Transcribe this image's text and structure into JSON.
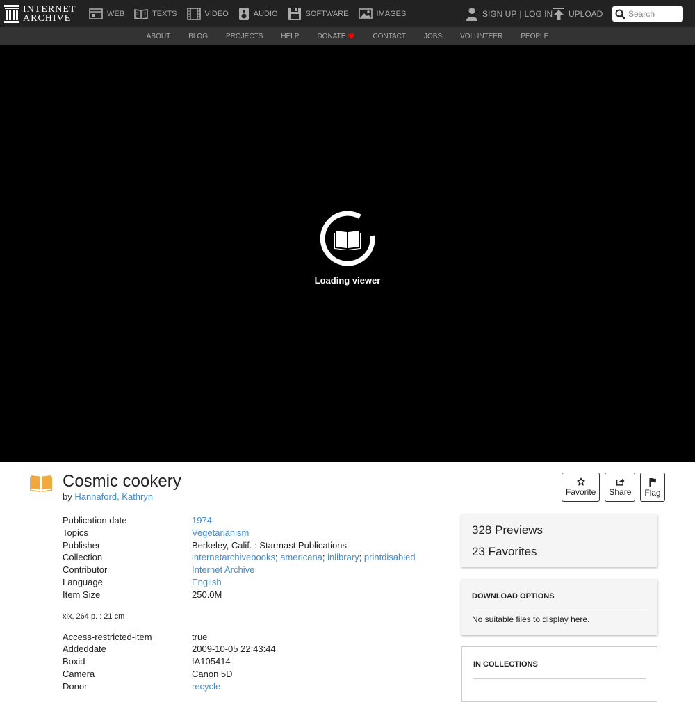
{
  "brand": {
    "line1": "INTERNET",
    "line2": "ARCHIVE"
  },
  "media_nav": [
    {
      "label": "WEB",
      "icon": "web-icon"
    },
    {
      "label": "TEXTS",
      "icon": "texts-icon"
    },
    {
      "label": "VIDEO",
      "icon": "video-icon"
    },
    {
      "label": "AUDIO",
      "icon": "audio-icon"
    },
    {
      "label": "SOFTWARE",
      "icon": "software-icon"
    },
    {
      "label": "IMAGES",
      "icon": "images-icon"
    }
  ],
  "user": {
    "signup": "SIGN UP",
    "separator": "|",
    "login": "LOG IN",
    "upload": "UPLOAD"
  },
  "search": {
    "placeholder": "Search"
  },
  "sub_nav": [
    "ABOUT",
    "BLOG",
    "PROJECTS",
    "HELP",
    "DONATE",
    "CONTACT",
    "JOBS",
    "VOLUNTEER",
    "PEOPLE"
  ],
  "viewer": {
    "loading_text": "Loading viewer"
  },
  "item": {
    "title": "Cosmic cookery",
    "by_label": "by",
    "author": "Hannaford, Kathryn"
  },
  "actions": {
    "favorite": "Favorite",
    "share": "Share",
    "flag": "Flag"
  },
  "metadata": {
    "publication_date": {
      "key": "Publication date",
      "value": "1974"
    },
    "topics": {
      "key": "Topics",
      "value": "Vegetarianism"
    },
    "publisher": {
      "key": "Publisher",
      "value": "Berkeley, Calif. : Starmast Publications"
    },
    "collection": {
      "key": "Collection",
      "values": [
        "internetarchivebooks",
        "americana",
        "inlibrary",
        "printdisabled"
      ]
    },
    "contributor": {
      "key": "Contributor",
      "value": "Internet Archive"
    },
    "language": {
      "key": "Language",
      "value": "English"
    },
    "item_size": {
      "key": "Item Size",
      "value": "250.0M"
    },
    "note": "xix, 264 p. : 21 cm",
    "access_restricted": {
      "key": "Access-restricted-item",
      "value": "true"
    },
    "addeddate": {
      "key": "Addeddate",
      "value": "2009-10-05 22:43:44"
    },
    "boxid": {
      "key": "Boxid",
      "value": "IA105414"
    },
    "camera": {
      "key": "Camera",
      "value": "Canon 5D"
    },
    "donor": {
      "key": "Donor",
      "value": "recycle"
    }
  },
  "stats": {
    "previews": "328 Previews",
    "favorites": "23 Favorites"
  },
  "download": {
    "heading": "DOWNLOAD OPTIONS",
    "note": "No suitable files to display here."
  },
  "collections": {
    "heading": "IN COLLECTIONS"
  },
  "colors": {
    "link": "#428bca",
    "nav_bg": "#222222",
    "subnav_bg": "#333333",
    "donate_heart": "#ff0000"
  }
}
